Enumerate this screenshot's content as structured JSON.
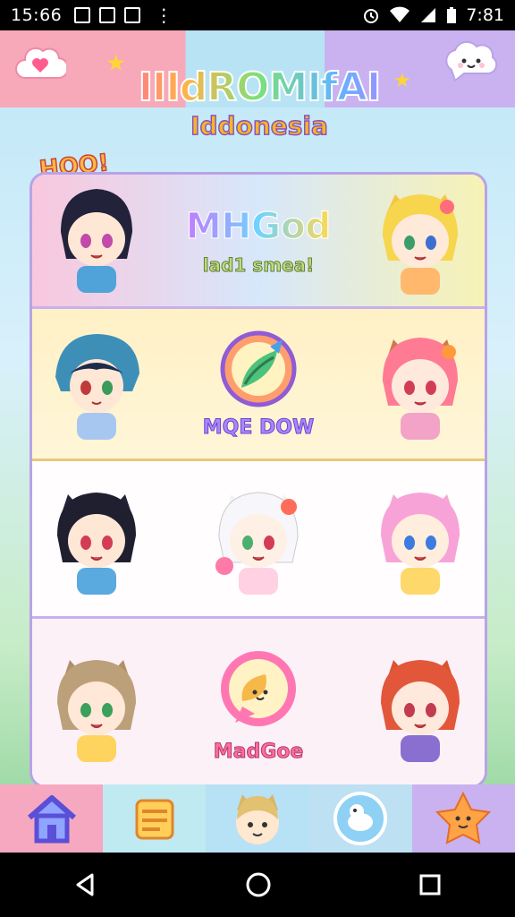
{
  "status_bar": {
    "time_left": "15:66",
    "time_right": "7:81",
    "notification_icons": [
      "notification-icon",
      "notification-icon",
      "notification-icon"
    ],
    "right_icons": [
      "alarm-icon",
      "wifi-icon",
      "signal-icon",
      "battery-icon"
    ]
  },
  "header": {
    "title": "IIIdROMIfAI",
    "subtitle": "Iddonesia",
    "left_button_icon": "heart-cloud-icon",
    "right_button_icon": "chat-bubble-icon"
  },
  "grid": {
    "badge": "HOO!",
    "rows": [
      {
        "center_title": "MHGod",
        "center_subtitle": "lad1 smea!"
      },
      {
        "center_label": "MQE DOW",
        "center_icon": "rainbow-leaf-logo-icon"
      },
      {
        "characters": [
          "black-hair-cat-girl",
          "white-hair-flower-girl",
          "pink-hair-cat-girl"
        ]
      },
      {
        "center_label": "MadGoe",
        "center_icon": "smiling-leaf-bubble-icon"
      }
    ]
  },
  "bottom_tabs": [
    {
      "icon": "home-icon"
    },
    {
      "icon": "notebook-icon"
    },
    {
      "icon": "character-face-icon"
    },
    {
      "icon": "bird-badge-icon"
    },
    {
      "icon": "star-face-icon"
    }
  ],
  "nav_bar": {
    "buttons": [
      "back-icon",
      "home-circle-icon",
      "recents-icon"
    ]
  },
  "colors": {
    "accent_pink": "#f7a8b9",
    "accent_blue": "#b7e3f5",
    "accent_purple": "#c9b2ef",
    "grid_border": "#b9a3e6"
  }
}
